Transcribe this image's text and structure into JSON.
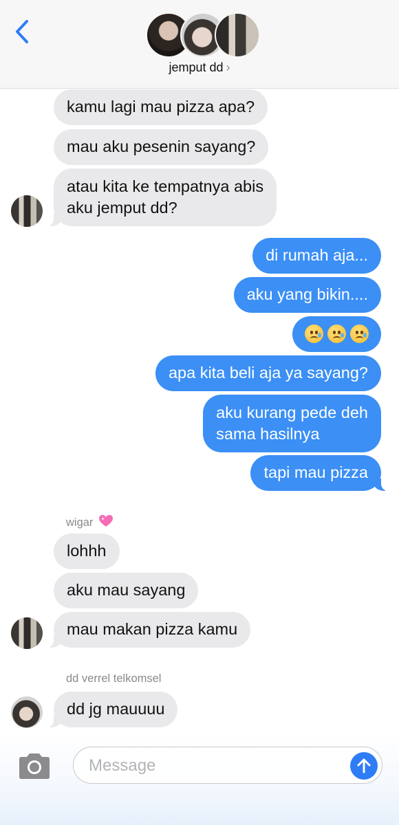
{
  "header": {
    "title": "jemput dd",
    "chevron": "›",
    "back_icon": "chevron-left-icon",
    "accent": "#2f7df6"
  },
  "messages": [
    {
      "id": "m1",
      "dir": "in",
      "text": "kamu lagi mau pizza apa?"
    },
    {
      "id": "m2",
      "dir": "in",
      "text": "mau aku pesenin sayang?"
    },
    {
      "id": "m3",
      "dir": "in",
      "lines": [
        "atau kita ke tempatnya abis",
        "aku jemput dd?"
      ]
    },
    {
      "id": "m4",
      "dir": "out",
      "text": "di rumah aja..."
    },
    {
      "id": "m5",
      "dir": "out",
      "text": "aku yang bikin...."
    },
    {
      "id": "m6",
      "dir": "out",
      "emoji": [
        "sad-but-relieved-face-emoji",
        "sad-but-relieved-face-emoji",
        "sad-but-relieved-face-emoji"
      ]
    },
    {
      "id": "m7",
      "dir": "out",
      "text": "apa kita beli aja ya sayang?"
    },
    {
      "id": "m8",
      "dir": "out",
      "lines": [
        "aku kurang pede deh",
        "sama hasilnya"
      ]
    },
    {
      "id": "m9",
      "dir": "out",
      "text": "tapi mau pizza"
    },
    {
      "id": "m10",
      "dir": "in",
      "text": "lohhh"
    },
    {
      "id": "m11",
      "dir": "in",
      "text": "aku mau sayang"
    },
    {
      "id": "m12",
      "dir": "in",
      "text": "mau makan pizza kamu"
    },
    {
      "id": "m13",
      "dir": "in",
      "text": "dd jg mauuuu"
    }
  ],
  "senders": {
    "wigar": {
      "name": "wigar",
      "badge_icon": "sparkling-heart-emoji"
    },
    "dd": {
      "name": "dd verrel telkomsel"
    }
  },
  "composer": {
    "placeholder": "Message",
    "camera_icon": "camera-icon",
    "send_icon": "arrow-up-icon"
  },
  "colors": {
    "outgoing_bubble": "#3b8ff5",
    "incoming_bubble": "#e9e9eb",
    "send_button": "#2f7df6"
  }
}
